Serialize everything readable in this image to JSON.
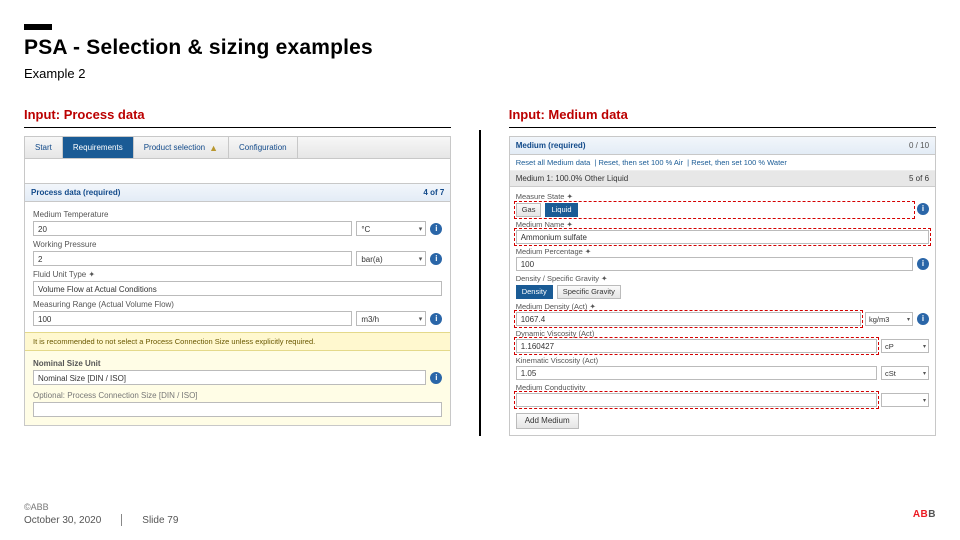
{
  "header": {
    "title": "PSA - Selection & sizing examples",
    "subtitle": "Example 2"
  },
  "left": {
    "heading": "Input: Process data",
    "tabs": {
      "start": "Start",
      "req": "Requirements",
      "product": "Product selection",
      "config": "Configuration"
    },
    "section_title": "Process data (required)",
    "section_progress": "4 of 7",
    "medium_temp": {
      "label": "Medium Temperature",
      "value": "20",
      "unit": "°C"
    },
    "working_pressure": {
      "label": "Working Pressure",
      "value": "2",
      "unit": "bar(a)"
    },
    "fluid_unit": {
      "label": "Fluid Unit Type ✦",
      "value": "Volume Flow at Actual Conditions"
    },
    "measuring_range": {
      "label": "Measuring Range (Actual Volume Flow)",
      "value": "100",
      "unit": "m3/h"
    },
    "note": "It is recommended to not select a Process Connection Size unless explicitly required.",
    "nominal": {
      "title": "Nominal Size Unit",
      "value": "Nominal Size [DIN / ISO]"
    },
    "optional_label": "Optional: Process Connection Size [DIN / ISO]"
  },
  "right": {
    "heading": "Input: Medium data",
    "section_title": "Medium (required)",
    "section_count": "0 / 10",
    "reset": {
      "a": "Reset all Medium data",
      "b": "Reset, then set 100 % Air",
      "c": "Reset, then set 100 % Water"
    },
    "medium_bar": {
      "name": "Medium 1: 100.0% Other Liquid",
      "count": "5 of 6"
    },
    "measure_state": {
      "label": "Measure State ✦",
      "btn_gas": "Gas",
      "btn_liquid": "Liquid"
    },
    "medium_name": {
      "label": "Medium Name ✦",
      "value": "Ammonium sulfate"
    },
    "percentage": {
      "label": "Medium Percentage ✦",
      "value": "100"
    },
    "density_section": {
      "label": "Density / Specific Gravity ✦",
      "btn_density": "Density",
      "btn_sg": "Specific Gravity"
    },
    "density": {
      "label": "Medium Density (Act) ✦",
      "value": "1067.4",
      "unit": "kg/m3"
    },
    "dyn_visc": {
      "label": "Dynamic Viscosity (Act)",
      "value": "1.160427",
      "unit": "cP"
    },
    "kin_visc": {
      "label": "Kinematic Viscosity (Act)",
      "value": "1.05",
      "unit": "cSt"
    },
    "conductivity": {
      "label": "Medium Conductivity",
      "value": "",
      "unit": ""
    },
    "add_btn": "Add Medium"
  },
  "footer": {
    "copyright": "©ABB",
    "date": "October 30, 2020",
    "slide": "Slide 79",
    "logo_a": "AB",
    "logo_b": "B"
  }
}
